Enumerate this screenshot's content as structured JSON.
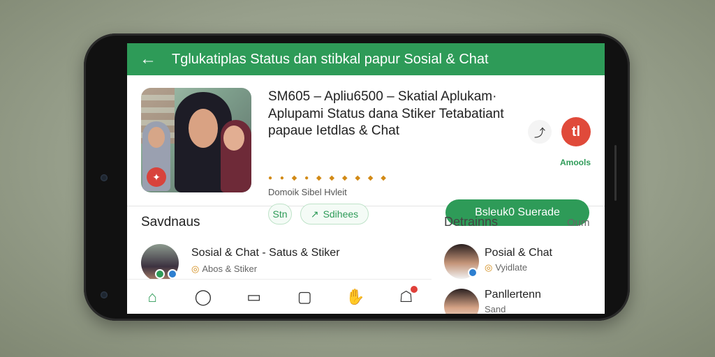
{
  "header": {
    "title": "Tglukatiplas Status dan stibkal papur Sosial & Chat"
  },
  "app": {
    "name": "SM605 – Apliu6500 – Skatial Aplukam·",
    "description": "Aplupami Status dana Stiker Tetabatiant papaue Ietdlas & Chat",
    "rating_text": "● ● ◆ ● ◆   ◆ ◆ ◆ ◆ ◆",
    "developer": "Domoik Sibel Hvleit",
    "chip_a": "Stn",
    "chip_b": "Sdihees",
    "logo_label": "Amools",
    "install_label": "Bsleuk0 Suerade"
  },
  "sections": {
    "left_heading": "Savdnaus",
    "right_heading": "Detrainns",
    "right_more": "Oum"
  },
  "list_left": [
    {
      "title": "Sosial & Chat - Satus & Stiker",
      "subtitle": "Abos & Stiker"
    }
  ],
  "list_right": [
    {
      "title": "Posial & Chat",
      "subtitle": "Vyidlate"
    },
    {
      "title": "Panllertenn",
      "subtitle": "Sand"
    }
  ],
  "colors": {
    "brand_green": "#2e9b58",
    "accent_red": "#e04a3a"
  },
  "icons": {
    "back": "back-arrow-icon",
    "share": "share-icon",
    "nav": [
      "home-icon",
      "chat-bubble-icon",
      "feed-icon",
      "message-icon",
      "sticker-icon",
      "notification-icon"
    ]
  }
}
